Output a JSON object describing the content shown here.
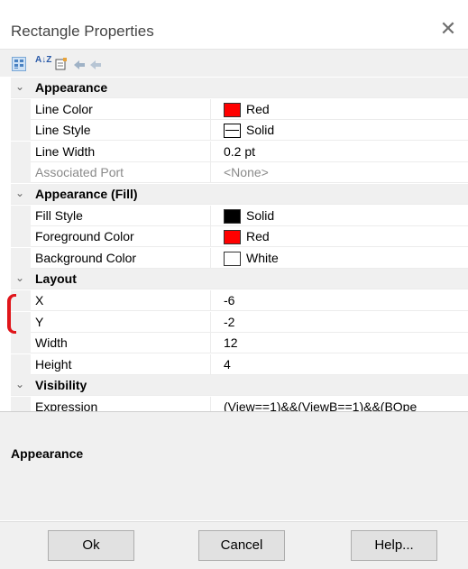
{
  "window": {
    "title": "Rectangle Properties",
    "close_glyph": "✕"
  },
  "toolbar": {
    "icons": [
      "categorized-icon",
      "alphabetical-icon",
      "property-pages-icon",
      "events-icon",
      "events-alt-icon"
    ],
    "az_text": "A↓Z"
  },
  "grid": {
    "appearance": {
      "label": "Appearance",
      "line_color": {
        "name": "Line Color",
        "value": "Red",
        "swatch": "#ff0000"
      },
      "line_style": {
        "name": "Line Style",
        "value": "Solid"
      },
      "line_width": {
        "name": "Line Width",
        "value": "0.2 pt"
      },
      "associated_port": {
        "name": "Associated Port",
        "value": "<None>"
      }
    },
    "appearance_fill": {
      "label": "Appearance (Fill)",
      "fill_style": {
        "name": "Fill Style",
        "value": "Solid",
        "swatch": "#000000"
      },
      "foreground_color": {
        "name": "Foreground Color",
        "value": "Red",
        "swatch": "#ff0000"
      },
      "background_color": {
        "name": "Background Color",
        "value": "White",
        "swatch": "#ffffff"
      }
    },
    "layout": {
      "label": "Layout",
      "x": {
        "name": "X",
        "value": "-6"
      },
      "y": {
        "name": "Y",
        "value": "-2"
      },
      "width": {
        "name": "Width",
        "value": "12"
      },
      "height": {
        "name": "Height",
        "value": "4"
      }
    },
    "visibility": {
      "label": "Visibility",
      "expression": {
        "name": "Expression",
        "value": "(View==1)&&(ViewB==1)&&(BOpe"
      }
    },
    "chevron": "⌄"
  },
  "description": {
    "title": "Appearance"
  },
  "buttons": {
    "ok": "Ok",
    "cancel": "Cancel",
    "help": "Help..."
  },
  "colors": {
    "highlight_bracket": "#e0151a"
  }
}
